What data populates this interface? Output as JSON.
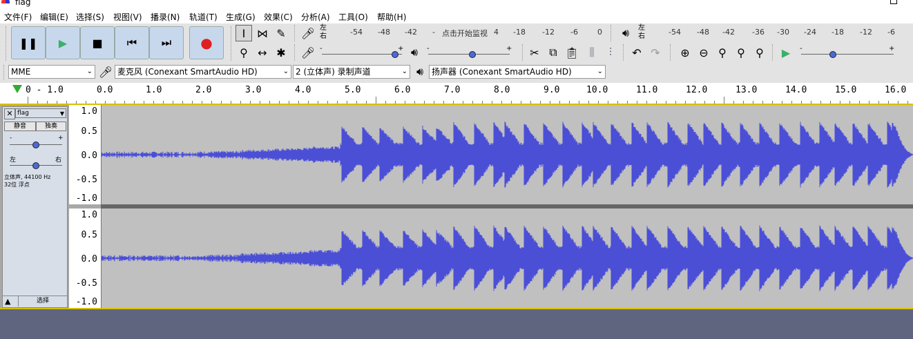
{
  "window": {
    "title": "flag"
  },
  "menu": [
    "文件(F)",
    "编辑(E)",
    "选择(S)",
    "视图(V)",
    "播录(N)",
    "轨道(T)",
    "生成(G)",
    "效果(C)",
    "分析(A)",
    "工具(O)",
    "帮助(H)"
  ],
  "transport": {
    "pause_icon": "pause-icon",
    "play_icon": "play-icon",
    "stop_icon": "stop-icon",
    "skip_start_icon": "skip-start-icon",
    "skip_end_icon": "skip-end-icon",
    "record_icon": "record-icon"
  },
  "meters": {
    "rec_lr_top": "左",
    "rec_lr_bottom": "右",
    "rec_ticks": [
      "-54",
      "-48",
      "-42",
      "-",
      "点击开始监视",
      "4",
      "-18",
      "-12",
      "-6",
      "0"
    ],
    "play_lr_top": "左",
    "play_lr_bottom": "右",
    "play_ticks": [
      "-54",
      "-48",
      "-42",
      "-36",
      "-30",
      "-24",
      "-18",
      "-12",
      "-6"
    ]
  },
  "mixer": {
    "rec_minus": "-",
    "rec_plus": "+",
    "rec_volume": 0.95,
    "play_minus": "-",
    "play_plus": "+",
    "play_volume": 0.55,
    "speed_minus": "-",
    "speed_plus": "+",
    "speed_value": 0.33
  },
  "devices": {
    "host": "MME",
    "rec_device": "麦克风 (Conexant SmartAudio HD)",
    "channels": "2 (立体声) 录制声道",
    "play_device": "扬声器 (Conexant SmartAudio HD)"
  },
  "timeline": {
    "labels": [
      "0 - 1.0",
      "0.0",
      "1.0",
      "2.0",
      "3.0",
      "4.0",
      "5.0",
      "6.0",
      "7.0",
      "8.0",
      "9.0",
      "10.0",
      "11.0",
      "12.0",
      "13.0",
      "14.0",
      "15.0",
      "16.0"
    ]
  },
  "track": {
    "name": "flag",
    "mute_label": "静音",
    "solo_label": "独奏",
    "gain_minus": "-",
    "gain_plus": "+",
    "gain_value": 0.5,
    "pan_left": "左",
    "pan_right": "右",
    "pan_value": 0.5,
    "info_line1": "立体声, 44100 Hz",
    "info_line2": "32位 浮点",
    "collapse_icon": "collapse-icon",
    "select_label": "选择"
  },
  "vruler": [
    "1.0",
    "0.5",
    "0.0",
    "-0.5",
    "-1.0"
  ],
  "colors": {
    "waveform": "#4b4fd6",
    "wave_bg": "#c0c0c0",
    "selection_border": "#d8c000",
    "bottom": "#5f657e"
  }
}
